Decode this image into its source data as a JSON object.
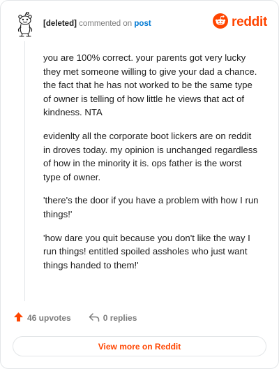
{
  "header": {
    "author": "[deleted]",
    "verb": "commented on",
    "target": "post",
    "brand": "reddit"
  },
  "comment": {
    "paragraphs": [
      "you are 100% correct. your parents got very lucky they met someone willing to give your dad a chance. the fact that he has not worked to be the same type of owner is telling of how little he views that act of kindness. NTA",
      "evidenlty all the corporate boot lickers are on reddit in droves today. my opinion is unchanged regardless of how in the minority it is. ops father is the worst type of owner.",
      "'there's the door if you have a problem with how I run things!'",
      "'how dare you quit because you don't like the way I run things! entitled spoiled assholes who just want things handed to them!'"
    ]
  },
  "footer": {
    "upvotes": "46 upvotes",
    "replies": "0 replies"
  },
  "view_more_label": "View more on Reddit",
  "colors": {
    "brand": "#ff4500",
    "link": "#0079d3",
    "muted": "#7c7c7c",
    "text": "#1c1c1c",
    "border": "#e3e6e8"
  },
  "icons": {
    "avatar": "snoo-avatar-icon",
    "logo": "reddit-logo-icon",
    "upvote": "upvote-arrow-icon",
    "reply": "reply-arrow-icon"
  }
}
